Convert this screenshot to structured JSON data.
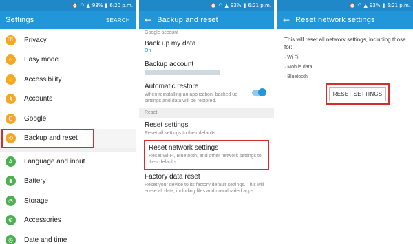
{
  "panels": [
    {
      "status": {
        "battery": "93%",
        "time": "6:20 p.m."
      },
      "title": "Settings",
      "action": "SEARCH",
      "items": [
        {
          "label": "Privacy",
          "icon": "privacy-icon",
          "color": "#f5a623",
          "glyph": "⚿"
        },
        {
          "label": "Easy mode",
          "icon": "easy-mode-icon",
          "color": "#f5a623",
          "glyph": "⌂"
        },
        {
          "label": "Accessibility",
          "icon": "accessibility-icon",
          "color": "#f5a623",
          "glyph": "✋"
        },
        {
          "label": "Accounts",
          "icon": "accounts-icon",
          "color": "#f5a623",
          "glyph": "⚷"
        },
        {
          "label": "Google",
          "icon": "google-icon",
          "color": "#f5a623",
          "glyph": "G"
        },
        {
          "label": "Backup and reset",
          "icon": "backup-reset-icon",
          "color": "#f5a623",
          "glyph": "⟲"
        },
        {
          "label": "Language and input",
          "icon": "language-icon",
          "color": "#4caf50",
          "glyph": "A"
        },
        {
          "label": "Battery",
          "icon": "battery-icon",
          "color": "#4caf50",
          "glyph": "▮"
        },
        {
          "label": "Storage",
          "icon": "storage-icon",
          "color": "#4caf50",
          "glyph": "◔"
        },
        {
          "label": "Accessories",
          "icon": "accessories-icon",
          "color": "#4caf50",
          "glyph": "⚙"
        },
        {
          "label": "Date and time",
          "icon": "date-time-icon",
          "color": "#4caf50",
          "glyph": "◷"
        }
      ]
    },
    {
      "status": {
        "battery": "93%",
        "time": "6:21 p.m."
      },
      "title": "Backup and reset",
      "google_account_header": "Google account",
      "backup_data": {
        "title": "Back up my data",
        "value": "On"
      },
      "backup_account": {
        "title": "Backup account"
      },
      "auto_restore": {
        "title": "Automatic restore",
        "subtitle": "When reinstalling an application, backed up settings and data will be restored."
      },
      "reset_header": "Reset",
      "reset_settings": {
        "title": "Reset settings",
        "subtitle": "Reset all settings to their defaults."
      },
      "reset_network": {
        "title": "Reset network settings",
        "subtitle": "Reset Wi-Fi, Bluetooth, and other network settings to their defaults."
      },
      "factory_reset": {
        "title": "Factory data reset",
        "subtitle": "Reset your device to its factory default settings. This will erase all data, including files and downloaded apps."
      }
    },
    {
      "status": {
        "battery": "93%",
        "time": "6:21 p.m."
      },
      "title": "Reset network settings",
      "description": "This will reset all network settings, including those for:",
      "bullets": [
        "· Wi-Fi",
        "· Mobile data",
        "· Bluetooth"
      ],
      "button": "RESET SETTINGS"
    }
  ],
  "colors": {
    "accent": "#2196d9",
    "highlight": "#d32f2f"
  }
}
